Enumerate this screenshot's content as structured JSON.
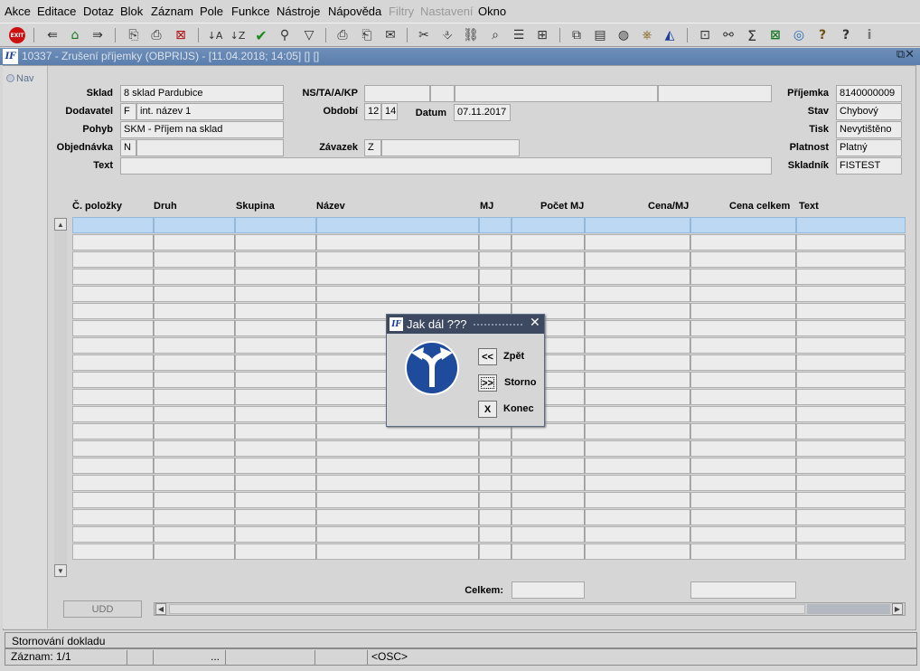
{
  "menu": {
    "items": [
      {
        "label": "Akce",
        "disabled": false
      },
      {
        "label": "Editace",
        "disabled": false
      },
      {
        "label": "Dotaz",
        "disabled": false
      },
      {
        "label": "Blok",
        "disabled": false
      },
      {
        "label": "Záznam",
        "disabled": false
      },
      {
        "label": "Pole",
        "disabled": false
      },
      {
        "label": "Funkce",
        "disabled": false
      },
      {
        "label": "Nástroje",
        "disabled": false
      },
      {
        "label": "Nápověda",
        "disabled": false
      },
      {
        "label": "Filtry",
        "disabled": true
      },
      {
        "label": "Nastavení",
        "disabled": true
      },
      {
        "label": "Okno",
        "disabled": false
      }
    ]
  },
  "toolbar": {
    "exit_label": "EXIT",
    "icons": [
      "exit-icon",
      "save-icon",
      "insert-record-icon",
      "delete-record-icon",
      "enter-query-icon",
      "execute-query-icon",
      "cancel-query-icon",
      "sort-asc-icon",
      "sort-desc-icon",
      "check-icon",
      "wrench-icon",
      "filter-icon",
      "print-icon",
      "print-preview-icon",
      "mail-icon",
      "cut-icon",
      "paste-icon",
      "link-icon",
      "search-list-icon",
      "indent-icon",
      "tree-icon",
      "document-copy-icon",
      "document-icon",
      "globe-icon",
      "settings-wheel-icon",
      "map-icon",
      "chart-icon",
      "mail-merge-icon",
      "sum-icon",
      "excel-icon",
      "ie-icon",
      "help-question-icon",
      "context-help-icon",
      "info-icon"
    ]
  },
  "window": {
    "title": "10337 - Zrušení příjemky (OBPRIJS) - [11.04.2018; 14:05]  []  []",
    "logo": "IF",
    "controls": "⧉✕"
  },
  "nav_button": "Nav",
  "form": {
    "sklad": {
      "label": "Sklad",
      "value": "8  sklad Pardubice"
    },
    "dodavatel": {
      "label": "Dodavatel",
      "code": "F",
      "name": "int. název 1"
    },
    "pohyb": {
      "label": "Pohyb",
      "value": "SKM - Příjem na sklad"
    },
    "objednavka": {
      "label": "Objednávka",
      "code": "N",
      "value": ""
    },
    "text": {
      "label": "Text",
      "value": ""
    },
    "nstakp": {
      "label": "NS/TA/A/KP",
      "ns": "",
      "ta": "",
      "a": "",
      "kp": ""
    },
    "obdobi": {
      "label": "Období",
      "month": "12",
      "year": "14"
    },
    "datum": {
      "label": "Datum",
      "value": "07.11.2017"
    },
    "zavazek": {
      "label": "Závazek",
      "code": "Z",
      "value": ""
    },
    "prijemka": {
      "label": "Příjemka",
      "value": "8140000009"
    },
    "stav": {
      "label": "Stav",
      "value": "Chybový"
    },
    "tisk": {
      "label": "Tisk",
      "value": "Nevytištěno"
    },
    "platnost": {
      "label": "Platnost",
      "value": "Platný"
    },
    "skladnik": {
      "label": "Skladník",
      "value": "FISTEST"
    }
  },
  "grid": {
    "columns": [
      "Č. položky",
      "Druh",
      "Skupina",
      "Název",
      "MJ",
      "Počet MJ",
      "Cena/MJ",
      "Cena celkem",
      "Text"
    ],
    "rows": 20,
    "selected_row": 1
  },
  "totals": {
    "label": "Celkem:",
    "count_value": "",
    "price_value": ""
  },
  "udd_button": "UDD",
  "dialog": {
    "logo": "IF",
    "title": "Jak dál ???",
    "close": "✕",
    "buttons": [
      {
        "symbol": "<<",
        "label": "Zpět"
      },
      {
        "symbol": ">>",
        "label": "Storno"
      },
      {
        "symbol": "X",
        "label": "Konec"
      }
    ],
    "sign_color": "#1f4b9c"
  },
  "status": {
    "message": "Stornování dokladu",
    "record": "Záznam: 1/1",
    "ellipsis": "...",
    "mode": "<OSC>"
  }
}
